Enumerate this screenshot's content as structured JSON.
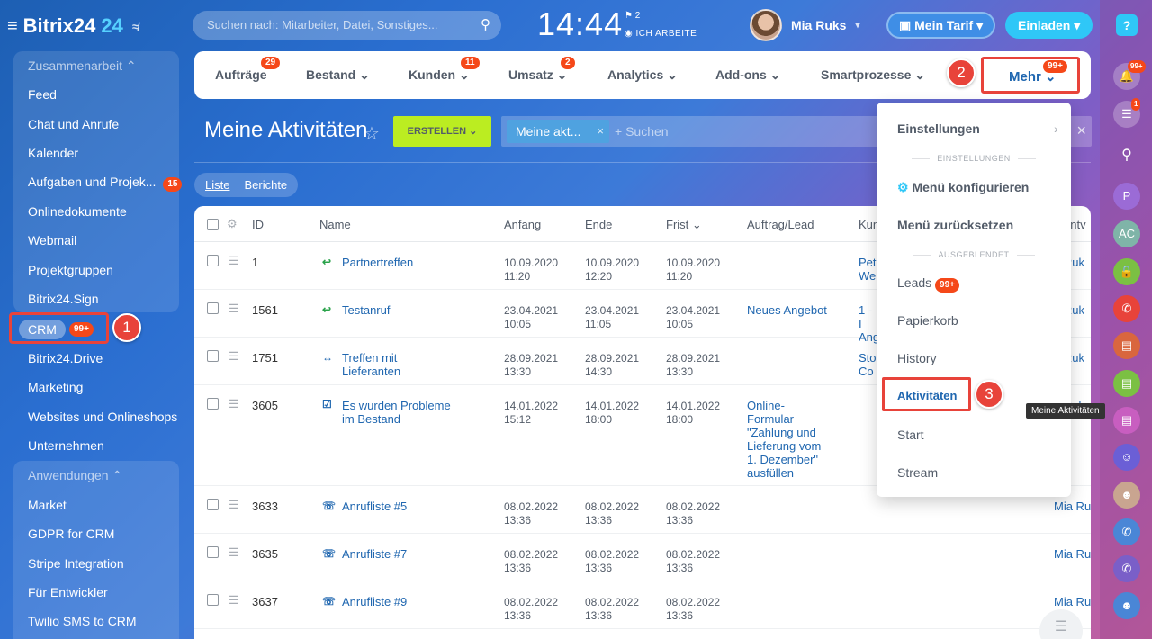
{
  "header": {
    "logo_main": "Bitrix24",
    "logo_num": "24",
    "search_placeholder": "Suchen nach: Mitarbeiter, Datei, Sonstiges...",
    "clock": "14:44",
    "flag_count": "2",
    "work_status": "ICH ARBEITE",
    "user_name": "Mia Ruks",
    "tarif_label": "Mein Tarif",
    "invite_label": "Einladen",
    "help_label": "?"
  },
  "sidebar": {
    "group1_title": "Zusammenarbeit",
    "group1_items": [
      "Feed",
      "Chat und Anrufe",
      "Kalender",
      "Aufgaben und Projek...",
      "Onlinedokumente",
      "Webmail",
      "Projektgruppen",
      "Bitrix24.Sign"
    ],
    "tasks_badge": "15",
    "crm_label": "CRM",
    "crm_badge": "99+",
    "items_after_crm": [
      "Bitrix24.Drive",
      "Marketing",
      "Websites und Onlineshops",
      "Unternehmen"
    ],
    "group2_title": "Anwendungen",
    "group2_items": [
      "Market",
      "GDPR for CRM",
      "Stripe Integration",
      "Für Entwickler",
      "Twilio SMS to CRM"
    ]
  },
  "steps": {
    "one": "1",
    "two": "2",
    "three": "3"
  },
  "topnav": {
    "items": [
      {
        "label": "Aufträge",
        "badge": "29"
      },
      {
        "label": "Bestand",
        "badge": ""
      },
      {
        "label": "Kunden",
        "badge": "11"
      },
      {
        "label": "Umsatz",
        "badge": "2"
      },
      {
        "label": "Analytics",
        "badge": ""
      },
      {
        "label": "Add-ons",
        "badge": ""
      },
      {
        "label": "Smartprozesse",
        "badge": ""
      }
    ],
    "more_label": "Mehr",
    "more_badge": "99+"
  },
  "page": {
    "title": "Meine Aktivitäten",
    "create_label": "ERSTELLEN",
    "filter_chip": "Meine akt...",
    "filter_placeholder": "+ Suchen",
    "tabs": [
      "Liste",
      "Berichte"
    ]
  },
  "table": {
    "columns": [
      "ID",
      "Name",
      "Anfang",
      "Ende",
      "Frist",
      "Auftrag/Lead",
      "Kun",
      "antv"
    ],
    "rows": [
      {
        "id": "1",
        "icon": "↩",
        "name": "Partnertreffen",
        "start": "10.09.2020 11:20",
        "end": "10.09.2020 12:20",
        "due": "10.09.2020 11:20",
        "deal": "",
        "client": "Pete Wei",
        "resp": "a Ruk"
      },
      {
        "id": "1561",
        "icon": "↩",
        "name": "Testanruf",
        "start": "23.04.2021 10:05",
        "end": "23.04.2021 11:05",
        "due": "23.04.2021 10:05",
        "deal": "Neues Angebot",
        "client": "1 - I Ang",
        "resp": "a Ruk"
      },
      {
        "id": "1751",
        "icon": "↔",
        "name": "Treffen mit Lieferanten",
        "start": "28.09.2021 13:30",
        "end": "28.09.2021 14:30",
        "due": "28.09.2021 13:30",
        "deal": "",
        "client": "Stol Co",
        "resp": "a Ruk"
      },
      {
        "id": "3605",
        "icon": "☑",
        "name": "Es wurden Probleme im Bestand",
        "start": "14.01.2022 15:12",
        "end": "14.01.2022 18:00",
        "due": "14.01.2022 18:00",
        "deal": "Online-Formular \"Zahlung und Lieferung vom 1. Dezember\" ausfüllen",
        "client": "",
        "resp": "a Ruk"
      },
      {
        "id": "3633",
        "icon": "☏",
        "name": "Anrufliste #5",
        "start": "08.02.2022 13:36",
        "end": "08.02.2022 13:36",
        "due": "08.02.2022 13:36",
        "deal": "",
        "client": "",
        "resp": "Mia Ruk"
      },
      {
        "id": "3635",
        "icon": "☏",
        "name": "Anrufliste #7",
        "start": "08.02.2022 13:36",
        "end": "08.02.2022 13:36",
        "due": "08.02.2022 13:36",
        "deal": "",
        "client": "",
        "resp": "Mia Ruk"
      },
      {
        "id": "3637",
        "icon": "☏",
        "name": "Anrufliste #9",
        "start": "08.02.2022 13:36",
        "end": "08.02.2022 13:36",
        "due": "08.02.2022 13:36",
        "deal": "",
        "client": "",
        "resp": "Mia Ruk"
      }
    ]
  },
  "menu": {
    "settings": "Einstellungen",
    "section1": "EINSTELLUNGEN",
    "configure": "Menü konfigurieren",
    "reset": "Menü zurücksetzen",
    "section2": "AUSGEBLENDET",
    "leads": "Leads",
    "leads_badge": "99+",
    "trash": "Papierkorb",
    "history": "History",
    "activities": "Aktivitäten",
    "start": "Start",
    "stream": "Stream"
  },
  "tooltip": "Meine Aktivitäten",
  "right_bar": {
    "bell_badge": "99+",
    "chat_badge": "1",
    "avatar_p": "P",
    "avatar_ac": "AC"
  }
}
